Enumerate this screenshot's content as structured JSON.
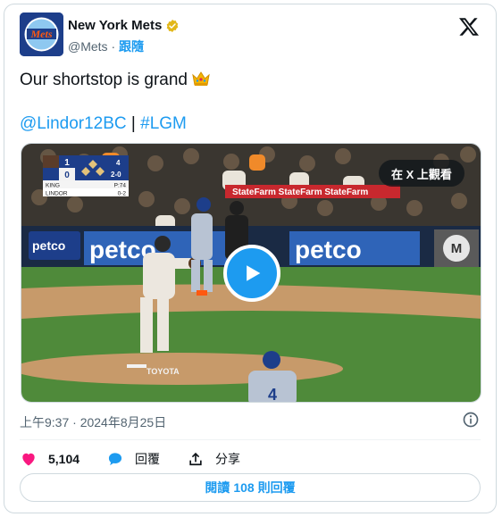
{
  "account": {
    "name": "New York Mets",
    "handle": "@Mets",
    "separator": "·",
    "follow_label": "跟隨"
  },
  "tweet": {
    "text": "Our shortstop is grand",
    "mention": "@Lindor12BC",
    "separator": "|",
    "hashtag": "#LGM"
  },
  "media": {
    "watch_label": "在 X 上觀看",
    "scorebug": {
      "inning": "4",
      "team1_score": "1",
      "team2_score": "0",
      "count": "2-0",
      "pitcher": "KING",
      "pitch_count": "P:74",
      "batter": "LINDOR",
      "batter_stats": "0-2"
    },
    "signs": [
      "petco",
      "petco",
      "petco",
      "StateFarm",
      "TOYOTA"
    ]
  },
  "meta": {
    "timestamp": "上午9:37 · 2024年8月25日"
  },
  "actions": {
    "like_count": "5,104",
    "reply_label": "回覆",
    "share_label": "分享"
  },
  "read_replies": {
    "prefix": "閱讀",
    "count": "108",
    "suffix": "則回覆"
  },
  "colors": {
    "accent": "#1d9bf0",
    "like": "#f91880",
    "mets_blue": "#1d3e8a",
    "mets_orange": "#ff5910"
  }
}
